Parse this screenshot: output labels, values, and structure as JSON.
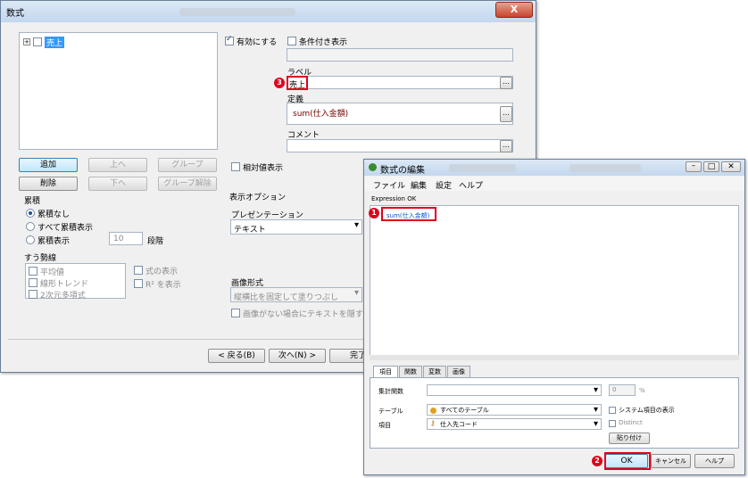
{
  "main_window": {
    "title": "数式",
    "close_label": "X",
    "tree_item": "売上",
    "enabled_label": "有効にする",
    "conditional_label": "条件付き表示",
    "label_caption": "ラベル",
    "label_value": "売上",
    "definition_caption": "定義",
    "definition_value": "sum(仕入金額)",
    "comment_caption": "コメント",
    "buttons": {
      "add": "追加",
      "up": "上へ",
      "group": "グループ",
      "delete": "削除",
      "down": "下へ",
      "ungroup": "グループ解除",
      "back": "< 戻る(B)",
      "next": "次へ(N) >",
      "finish": "完了"
    },
    "relative_label": "相対値表示",
    "accum_title": "累積",
    "accum_options": [
      "累積なし",
      "すべて累積表示",
      "累積表示"
    ],
    "accum_steps_value": "10",
    "accum_steps_label": "段階",
    "trend_title": "すう勢線",
    "trend_items": [
      "平均値",
      "線形トレンド",
      "2次元多項式"
    ],
    "show_formula_label": "式の表示",
    "show_r2_label": "R² を表示",
    "display_options_title": "表示オプション",
    "presentation_caption": "プレゼンテーション",
    "presentation_value": "テキスト",
    "image_format_caption": "画像形式",
    "image_format_value": "縦横比を固定して塗りつぶし",
    "hide_text_label": "画像がない場合にテキストを隠す"
  },
  "expr_dialog": {
    "title": "数式の編集",
    "menu": [
      "ファイル",
      "編集",
      "設定",
      "ヘルプ"
    ],
    "status": "Expression OK",
    "expression": "sum(仕入金額)",
    "tabs": [
      "項目",
      "関数",
      "変数",
      "画像"
    ],
    "aggregate_label": "集計関数",
    "aggregate_value": "",
    "aggregate_num": "0",
    "percent_label": "%",
    "table_label": "テーブル",
    "table_value": "すべてのテーブル",
    "field_label": "項目",
    "field_value": "仕入先コード",
    "system_fields_label": "システム項目の表示",
    "distinct_label": "Distinct",
    "paste_label": "貼り付け",
    "ok_label": "OK",
    "cancel_label": "キャンセル",
    "help_label": "ヘルプ"
  },
  "annotations": {
    "n1": "1",
    "n2": "2",
    "n3": "3"
  },
  "colors": {
    "highlight_red": "#e0001b",
    "selection_blue": "#3399ff",
    "expression_blue": "#1a4dc8",
    "expression_dark": "#7b0000"
  }
}
